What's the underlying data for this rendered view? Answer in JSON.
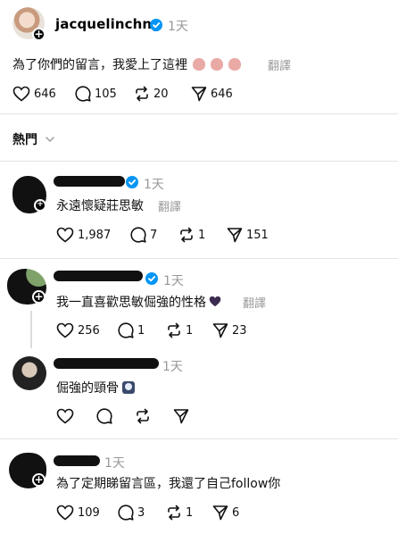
{
  "post": {
    "username": "jacquelinchng",
    "time": "1天",
    "text": "為了你們的留言，我愛上了這裡",
    "translate": "翻譯",
    "stats": {
      "likes": "646",
      "comments": "105",
      "reposts": "20",
      "shares": "646"
    }
  },
  "sort": {
    "label": "熱門"
  },
  "comments": [
    {
      "time": "1天",
      "text": "永遠懷疑莊思敏",
      "translate": "翻譯",
      "stats": {
        "likes": "1,987",
        "comments": "7",
        "reposts": "1",
        "shares": "151"
      }
    },
    {
      "time": "1天",
      "text": "我一直喜歡思敏倔強的性格",
      "translate": "翻譯",
      "stats": {
        "likes": "256",
        "comments": "1",
        "reposts": "1",
        "shares": "23"
      }
    },
    {
      "time": "1天",
      "text": "倔強的頸骨"
    },
    {
      "time": "1天",
      "text": "為了定期睇留言區，我還了自己follow你",
      "stats": {
        "likes": "109",
        "comments": "3",
        "reposts": "1",
        "shares": "6"
      }
    }
  ],
  "colors": {
    "verified": "#0095f6",
    "muted": "#999999",
    "divider": "#e4e4e4"
  }
}
